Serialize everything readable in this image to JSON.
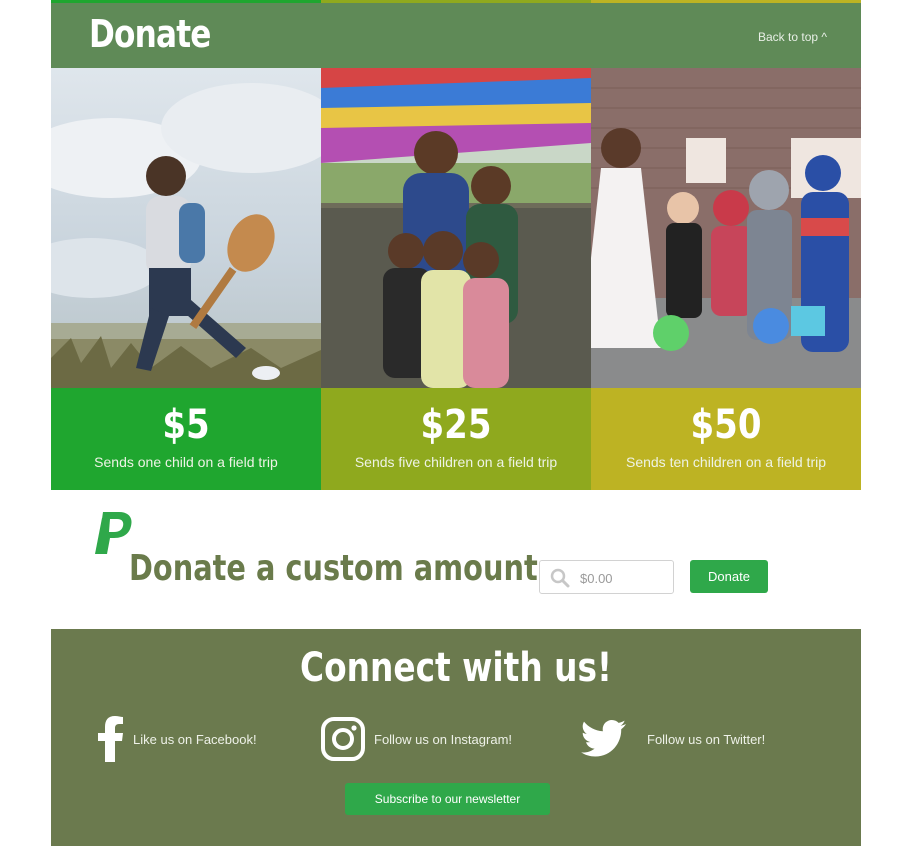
{
  "header": {
    "title": "Donate",
    "back_to_top": "Back to top ^"
  },
  "tiers": [
    {
      "amount": "$5",
      "caption": "Sends one child on a field trip",
      "color": "#1fa62f"
    },
    {
      "amount": "$25",
      "caption": "Sends five children on a field trip",
      "color": "#8fa91e"
    },
    {
      "amount": "$50",
      "caption": "Sends ten children on a field trip",
      "color": "#bdb323"
    }
  ],
  "custom": {
    "label": "Donate a custom amount:",
    "input_placeholder": "$0.00",
    "button_label": "Donate",
    "icon": "paypal-icon"
  },
  "connect": {
    "title": "Connect with us!",
    "facebook": "Like us on Facebook!",
    "instagram": "Follow us on Instagram!",
    "twitter": "Follow us on Twitter!",
    "subscribe_label": "Subscribe to our newsletter"
  },
  "colors": {
    "header_bg": "#5f8a57",
    "connect_bg": "#6b7a4e",
    "button_green": "#2fa84a",
    "custom_label": "#6a7b4b"
  }
}
